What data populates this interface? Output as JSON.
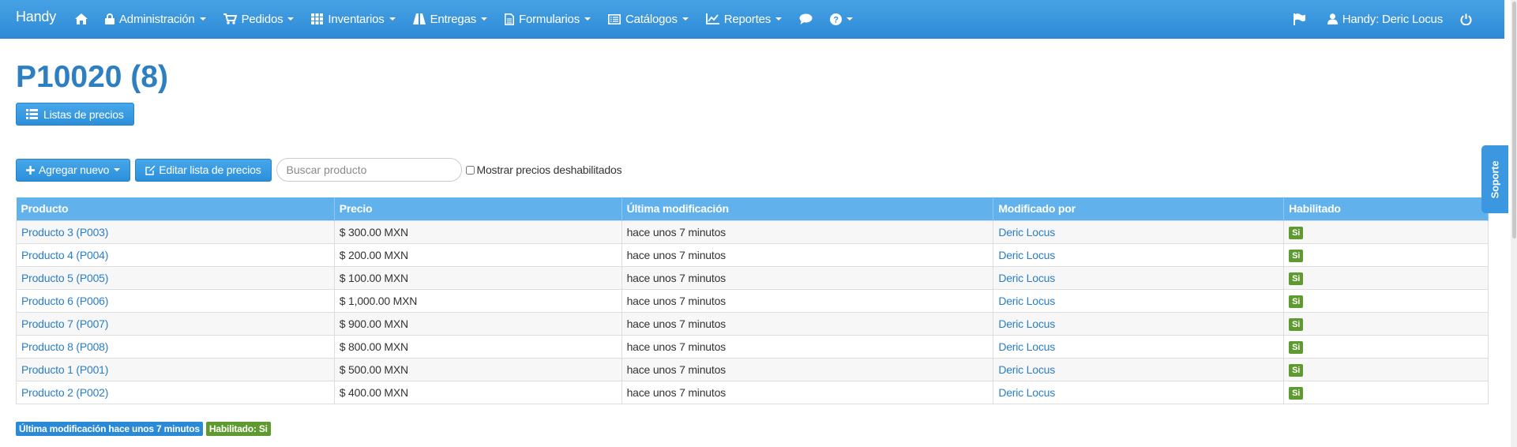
{
  "navbar": {
    "brand": "Handy",
    "items": [
      {
        "label": "Administración"
      },
      {
        "label": "Pedidos"
      },
      {
        "label": "Inventarios"
      },
      {
        "label": "Entregas"
      },
      {
        "label": "Formularios"
      },
      {
        "label": "Catálogos"
      },
      {
        "label": "Reportes"
      }
    ],
    "user_label": "Handy: Deric Locus"
  },
  "page": {
    "title": "P10020 (8)",
    "lists_button": "Listas de precios"
  },
  "toolbar": {
    "add_new": "Agregar nuevo",
    "edit_list": "Editar lista de precios",
    "search_placeholder": "Buscar producto",
    "show_disabled": "Mostrar precios deshabilitados"
  },
  "table": {
    "columns": [
      "Producto",
      "Precio",
      "Última modificación",
      "Modificado por",
      "Habilitado"
    ],
    "rows": [
      {
        "product": "Producto 3 (P003)",
        "price": "$ 300.00 MXN",
        "modified": "hace unos 7 minutos",
        "by": "Deric Locus",
        "enabled": "Si"
      },
      {
        "product": "Producto 4 (P004)",
        "price": "$ 200.00 MXN",
        "modified": "hace unos 7 minutos",
        "by": "Deric Locus",
        "enabled": "Si"
      },
      {
        "product": "Producto 5 (P005)",
        "price": "$ 100.00 MXN",
        "modified": "hace unos 7 minutos",
        "by": "Deric Locus",
        "enabled": "Si"
      },
      {
        "product": "Producto 6 (P006)",
        "price": "$ 1,000.00 MXN",
        "modified": "hace unos 7 minutos",
        "by": "Deric Locus",
        "enabled": "Si"
      },
      {
        "product": "Producto 7 (P007)",
        "price": "$ 900.00 MXN",
        "modified": "hace unos 7 minutos",
        "by": "Deric Locus",
        "enabled": "Si"
      },
      {
        "product": "Producto 8 (P008)",
        "price": "$ 800.00 MXN",
        "modified": "hace unos 7 minutos",
        "by": "Deric Locus",
        "enabled": "Si"
      },
      {
        "product": "Producto 1 (P001)",
        "price": "$ 500.00 MXN",
        "modified": "hace unos 7 minutos",
        "by": "Deric Locus",
        "enabled": "Si"
      },
      {
        "product": "Producto 2 (P002)",
        "price": "$ 400.00 MXN",
        "modified": "hace unos 7 minutos",
        "by": "Deric Locus",
        "enabled": "Si"
      }
    ]
  },
  "footer": {
    "last_modified_badge": "Última modificación hace unos 7 minutos",
    "enabled_badge": "Habilitado: Si"
  },
  "support": {
    "label": "Soporte"
  },
  "colors": {
    "navbar": "#3796de",
    "accent": "#2b8ad7",
    "table_header": "#61b2ec",
    "title": "#2d7fc1",
    "link": "#2a7ec5",
    "badge_green": "#5e9a30"
  },
  "icons": {
    "home": "home-icon",
    "admin": "lock-icon",
    "orders": "cart-icon",
    "inventory": "grid-icon",
    "deliveries": "road-icon",
    "forms": "document-icon",
    "catalogs": "list-alt-icon",
    "reports": "line-chart-icon",
    "chat": "chat-icon",
    "help": "question-icon",
    "flag": "flag-icon",
    "user": "user-icon",
    "logout": "power-icon"
  }
}
